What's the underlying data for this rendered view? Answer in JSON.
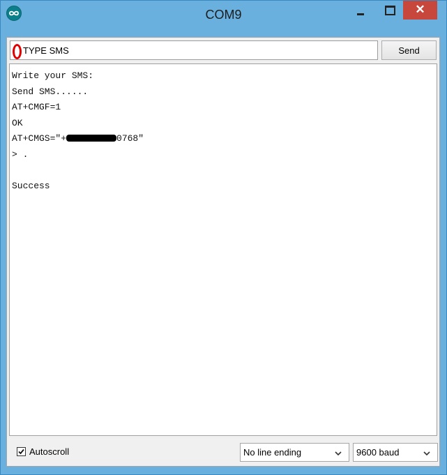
{
  "window": {
    "title": "COM9",
    "close_glyph": "✕"
  },
  "send_bar": {
    "input_value": "TYPE SMS",
    "send_label": "Send"
  },
  "output_lines": [
    "Write your SMS:",
    "Send SMS......",
    "AT+CMGF=1",
    "OK",
    "AT+CMGS=\"+",
    "> .",
    "",
    "Success"
  ],
  "redacted_suffix": "0768\"",
  "footer": {
    "autoscroll_label": "Autoscroll",
    "autoscroll_checked": true,
    "line_ending": "No line ending",
    "baud_rate": "9600 baud"
  },
  "icons": {
    "app": "arduino-infinity-icon",
    "minimize": "minimize-icon",
    "maximize": "maximize-icon",
    "close": "close-icon",
    "check": "checkmark-icon",
    "dropdown": "chevron-down-icon"
  },
  "colors": {
    "window_frame": "#6ab0de",
    "close_button": "#c7473d",
    "highlight_ring": "#e00000",
    "arduino_teal": "#0b7f8a"
  }
}
